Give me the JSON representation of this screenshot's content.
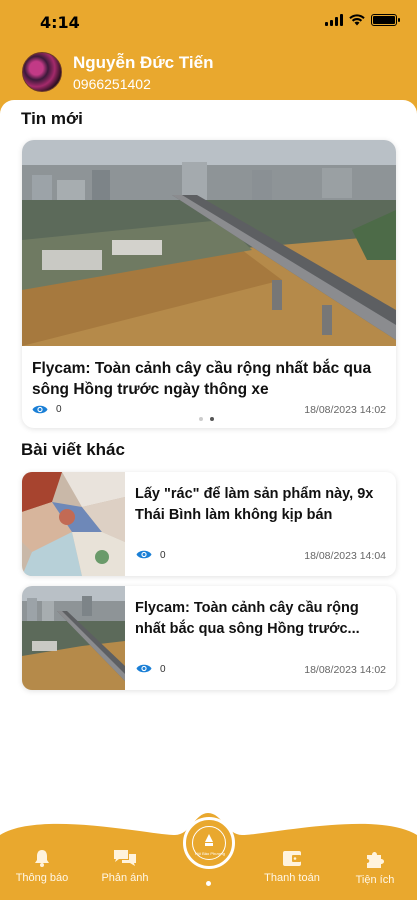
{
  "status_bar": {
    "time": "4:14"
  },
  "user": {
    "name": "Nguyễn Đức Tiến",
    "phone": "0966251402"
  },
  "sections": {
    "latest": "Tin mới",
    "others": "Bài viết khác"
  },
  "featured": {
    "title": "Flycam: Toàn cảnh cây cầu rộng nhất bắc qua sông Hồng trước ngày thông xe",
    "views": "0",
    "date": "18/08/2023 14:02"
  },
  "articles": [
    {
      "title": "Lấy \"rác\" để làm sản phẩm này, 9x Thái Bình làm không kịp bán",
      "views": "0",
      "date": "18/08/2023 14:04"
    },
    {
      "title": "Flycam: Toàn cảnh cây cầu rộng nhất bắc qua sông Hồng trước...",
      "views": "0",
      "date": "18/08/2023 14:02"
    }
  ],
  "nav": {
    "items": [
      {
        "label": "Thông báo",
        "icon": "bell-icon"
      },
      {
        "label": "Phản ánh",
        "icon": "chat-icon"
      },
      {
        "label": "Thanh toán",
        "icon": "wallet-icon"
      },
      {
        "label": "Tiện ích",
        "icon": "puzzle-icon"
      }
    ],
    "center_logo": "Hội Bảo Phương"
  },
  "colors": {
    "accent": "#e9a82e",
    "eye": "#1a7fd6",
    "background": "#ffffff"
  }
}
